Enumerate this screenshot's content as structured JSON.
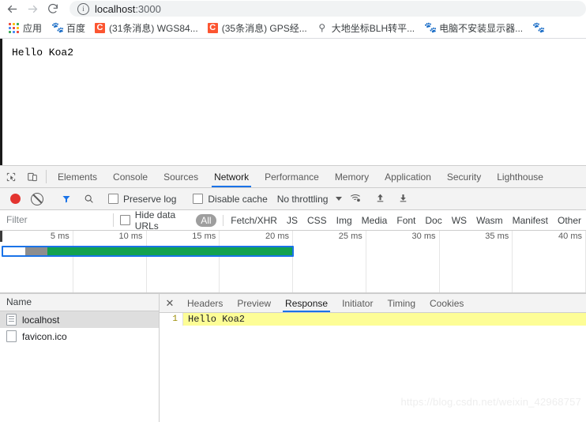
{
  "browser": {
    "back_icon": "back-arrow-icon",
    "forward_icon": "forward-arrow-icon",
    "reload_icon": "reload-icon",
    "site_info_icon": "info-icon",
    "url_host": "localhost",
    "url_rest": ":3000",
    "url_full": "localhost:3000"
  },
  "bookmarks": [
    {
      "icon": "apps-grid-icon",
      "label": "应用"
    },
    {
      "icon": "baidu-icon",
      "label": "百度"
    },
    {
      "icon": "csdn-icon",
      "label": "(31条消息) WGS84..."
    },
    {
      "icon": "csdn-icon",
      "label": "(35条消息) GPS经..."
    },
    {
      "icon": "bookmark-icon",
      "label": "大地坐标BLH转平..."
    },
    {
      "icon": "baidu-icon",
      "label": "电脑不安装显示器..."
    },
    {
      "icon": "baidu-icon",
      "label": ""
    }
  ],
  "page": {
    "body_text": "Hello Koa2"
  },
  "devtools": {
    "inspect_icon": "inspect-element-icon",
    "device_icon": "device-toolbar-icon",
    "tabs": [
      {
        "label": "Elements",
        "active": false
      },
      {
        "label": "Console",
        "active": false
      },
      {
        "label": "Sources",
        "active": false
      },
      {
        "label": "Network",
        "active": true
      },
      {
        "label": "Performance",
        "active": false
      },
      {
        "label": "Memory",
        "active": false
      },
      {
        "label": "Application",
        "active": false
      },
      {
        "label": "Security",
        "active": false
      },
      {
        "label": "Lighthouse",
        "active": false
      }
    ],
    "controls": {
      "record_icon": "record-button-icon",
      "clear_icon": "clear-icon",
      "filter_icon": "funnel-filter-icon",
      "search_icon": "search-icon",
      "preserve_log_label": "Preserve log",
      "preserve_log_checked": false,
      "disable_cache_label": "Disable cache",
      "disable_cache_checked": false,
      "throttling_value": "No throttling",
      "throttling_caret_icon": "chevron-down-icon",
      "network_conditions_icon": "wifi-settings-icon",
      "import_har_icon": "upload-arrow-icon",
      "export_har_icon": "download-arrow-icon"
    },
    "filterbar": {
      "filter_placeholder": "Filter",
      "filter_value": "",
      "hide_data_urls_label": "Hide data URLs",
      "hide_data_urls_checked": false,
      "types": [
        "All",
        "Fetch/XHR",
        "JS",
        "CSS",
        "Img",
        "Media",
        "Font",
        "Doc",
        "WS",
        "Wasm",
        "Manifest",
        "Other"
      ],
      "active_type": "All"
    },
    "overview": {
      "ticks": [
        "5 ms",
        "10 ms",
        "15 ms",
        "20 ms",
        "25 ms",
        "30 ms",
        "35 ms",
        "40 ms"
      ],
      "selection_color": "#1a73e8",
      "bar_color": "#12a150",
      "queue_color": "#8e8e8e"
    },
    "requests": {
      "column_name": "Name",
      "rows": [
        {
          "name": "localhost",
          "icon": "document-icon",
          "selected": true
        },
        {
          "name": "favicon.ico",
          "icon": "file-icon",
          "selected": false
        }
      ]
    },
    "detail": {
      "close_icon": "close-icon",
      "tabs": [
        {
          "label": "Headers",
          "active": false
        },
        {
          "label": "Preview",
          "active": false
        },
        {
          "label": "Response",
          "active": true
        },
        {
          "label": "Initiator",
          "active": false
        },
        {
          "label": "Timing",
          "active": false
        },
        {
          "label": "Cookies",
          "active": false
        }
      ],
      "response": {
        "lines": [
          {
            "number": "1",
            "text": "Hello Koa2"
          }
        ]
      }
    }
  },
  "watermark": "https://blog.csdn.net/weixin_42968757"
}
